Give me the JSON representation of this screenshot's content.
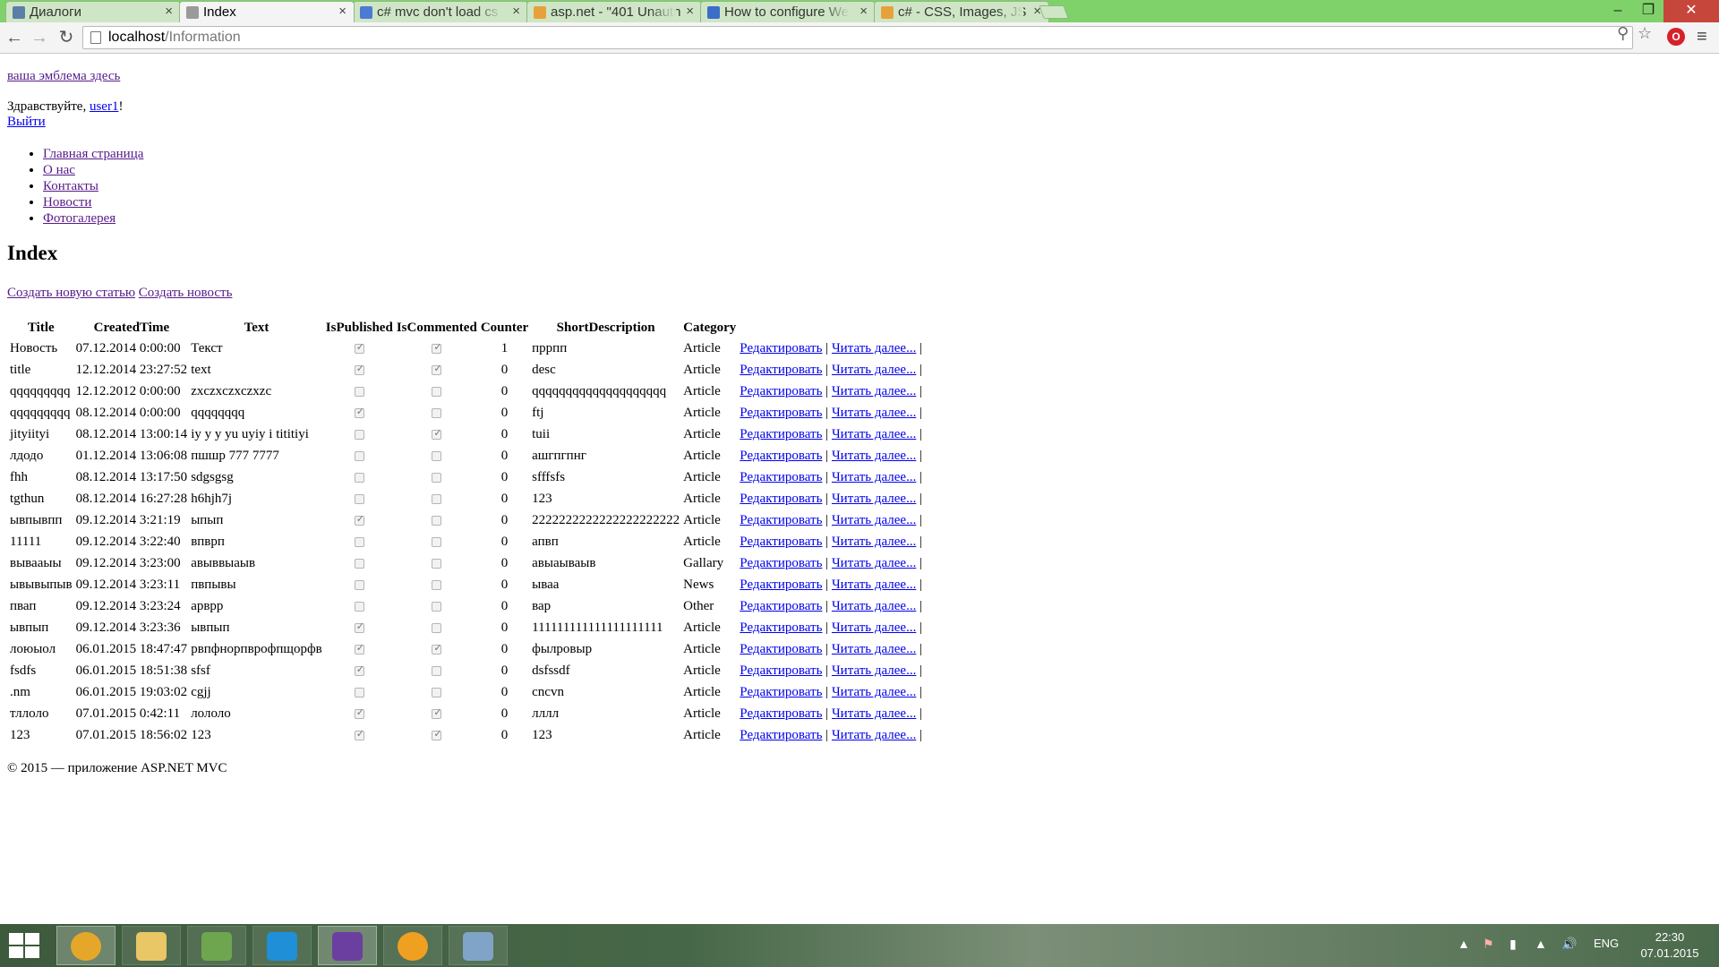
{
  "tabs": [
    {
      "label": "Диалоги",
      "icon": "vk-icon",
      "color": "#5b7fa6"
    },
    {
      "label": "Index",
      "icon": "page-icon",
      "color": "#9a9a9a"
    },
    {
      "label": "c# mvc don't load cs",
      "icon": "google-icon",
      "color": "#4b7bd4"
    },
    {
      "label": "asp.net - \"401 Unauth",
      "icon": "stackoverflow-icon",
      "color": "#e8a13a"
    },
    {
      "label": "How to configure We",
      "icon": "loading-icon",
      "color": "#3a6ec9"
    },
    {
      "label": "c# - CSS, Images, JS",
      "icon": "stackoverflow-icon",
      "color": "#e8a13a"
    }
  ],
  "address": {
    "host": "localhost",
    "path": "/Information"
  },
  "site": {
    "logo_link": "ваша эмблема здесь",
    "greeting_prefix": "Здравствуйте, ",
    "username": "user1",
    "greeting_suffix": "!",
    "logout": "Выйти",
    "nav": [
      "Главная страница",
      "О нас",
      "Контакты",
      "Новости",
      "Фотогалерея"
    ],
    "heading": "Index",
    "create_article": "Создать новую статью",
    "create_news": "Создать новость",
    "footer": "© 2015 — приложение ASP.NET MVC"
  },
  "table": {
    "headers": [
      "Title",
      "CreatedTime",
      "Text",
      "IsPublished",
      "IsCommented",
      "Counter",
      "ShortDescription",
      "Category"
    ],
    "edit_label": "Редактировать",
    "read_label": "Читать далее...",
    "separator": "|",
    "rows": [
      {
        "title": "Новость",
        "created": "07.12.2014 0:00:00",
        "text": "Текст",
        "published": true,
        "commented": true,
        "counter": "1",
        "short": "пррпп",
        "category": "Article"
      },
      {
        "title": "title",
        "created": "12.12.2014 23:27:52",
        "text": "text",
        "published": true,
        "commented": true,
        "counter": "0",
        "short": "desc",
        "category": "Article"
      },
      {
        "title": "qqqqqqqqq",
        "created": "12.12.2012 0:00:00",
        "text": "zxczxczxczxzc",
        "published": false,
        "commented": false,
        "counter": "0",
        "short": "qqqqqqqqqqqqqqqqqqqq",
        "category": "Article"
      },
      {
        "title": "qqqqqqqqq",
        "created": "08.12.2014 0:00:00",
        "text": "qqqqqqqq",
        "published": true,
        "commented": false,
        "counter": "0",
        "short": "ftj",
        "category": "Article"
      },
      {
        "title": "jityiityi",
        "created": "08.12.2014 13:00:14",
        "text": "iy y y yu uyiy i tititiyi",
        "published": false,
        "commented": true,
        "counter": "0",
        "short": "tuii",
        "category": "Article"
      },
      {
        "title": "лдодо",
        "created": "01.12.2014 13:06:08",
        "text": "пшшр 777 7777",
        "published": false,
        "commented": false,
        "counter": "0",
        "short": "ашгпгпнг",
        "category": "Article"
      },
      {
        "title": "fhh",
        "created": "08.12.2014 13:17:50",
        "text": "sdgsgsg",
        "published": false,
        "commented": false,
        "counter": "0",
        "short": "sfffsfs",
        "category": "Article"
      },
      {
        "title": "tgthun",
        "created": "08.12.2014 16:27:28",
        "text": "h6hjh7j",
        "published": false,
        "commented": false,
        "counter": "0",
        "short": "123",
        "category": "Article"
      },
      {
        "title": "ывпывпп",
        "created": "09.12.2014 3:21:19",
        "text": "ыпып",
        "published": true,
        "commented": false,
        "counter": "0",
        "short": "2222222222222222222222",
        "category": "Article"
      },
      {
        "title": "11111",
        "created": "09.12.2014 3:22:40",
        "text": "впврп",
        "published": false,
        "commented": false,
        "counter": "0",
        "short": "апвп",
        "category": "Article"
      },
      {
        "title": "вывааыы",
        "created": "09.12.2014 3:23:00",
        "text": "авыввыаыв",
        "published": false,
        "commented": false,
        "counter": "0",
        "short": "авыаываыв",
        "category": "Gallary"
      },
      {
        "title": "ывывыпыв",
        "created": "09.12.2014 3:23:11",
        "text": "пвпывы",
        "published": false,
        "commented": false,
        "counter": "0",
        "short": "ываа",
        "category": "News"
      },
      {
        "title": "пвап",
        "created": "09.12.2014 3:23:24",
        "text": "арврр",
        "published": false,
        "commented": false,
        "counter": "0",
        "short": "вар",
        "category": "Other"
      },
      {
        "title": "ывпып",
        "created": "09.12.2014 3:23:36",
        "text": "ывпып",
        "published": true,
        "commented": false,
        "counter": "0",
        "short": "111111111111111111111",
        "category": "Article"
      },
      {
        "title": "лоюыол",
        "created": "06.01.2015 18:47:47",
        "text": "рвпфнорпврофпщорфв",
        "published": true,
        "commented": true,
        "counter": "0",
        "short": "фылровыр",
        "category": "Article"
      },
      {
        "title": "fsdfs",
        "created": "06.01.2015 18:51:38",
        "text": "sfsf",
        "published": true,
        "commented": false,
        "counter": "0",
        "short": "dsfssdf",
        "category": "Article"
      },
      {
        "title": ".nm",
        "created": "06.01.2015 19:03:02",
        "text": "cgjj",
        "published": false,
        "commented": false,
        "counter": "0",
        "short": "cncvn",
        "category": "Article"
      },
      {
        "title": "тллоло",
        "created": "07.01.2015 0:42:11",
        "text": "лололо",
        "published": true,
        "commented": true,
        "counter": "0",
        "short": "лллл",
        "category": "Article"
      },
      {
        "title": "123",
        "created": "07.01.2015 18:56:02",
        "text": "123",
        "published": true,
        "commented": true,
        "counter": "0",
        "short": "123",
        "category": "Article"
      }
    ]
  },
  "taskbar": {
    "apps": [
      {
        "name": "chrome",
        "icon": "chrome-icon",
        "color": "#e5a72a",
        "active": true
      },
      {
        "name": "explorer",
        "icon": "folder-icon",
        "color": "#e9c666",
        "active": false
      },
      {
        "name": "image-editor",
        "icon": "paint-icon",
        "color": "#6ea64f",
        "active": false
      },
      {
        "name": "webstorm",
        "icon": "webstorm-icon",
        "color": "#1f8fd8",
        "active": false
      },
      {
        "name": "visual-studio",
        "icon": "visual-studio-icon",
        "color": "#6b3fa0",
        "active": true
      },
      {
        "name": "aimp",
        "icon": "aimp-icon",
        "color": "#f0a020",
        "active": false
      },
      {
        "name": "network-app",
        "icon": "network-app-icon",
        "color": "#7fa4c8",
        "active": false
      }
    ],
    "language": "ENG",
    "time": "22:30",
    "date": "07.01.2015"
  }
}
